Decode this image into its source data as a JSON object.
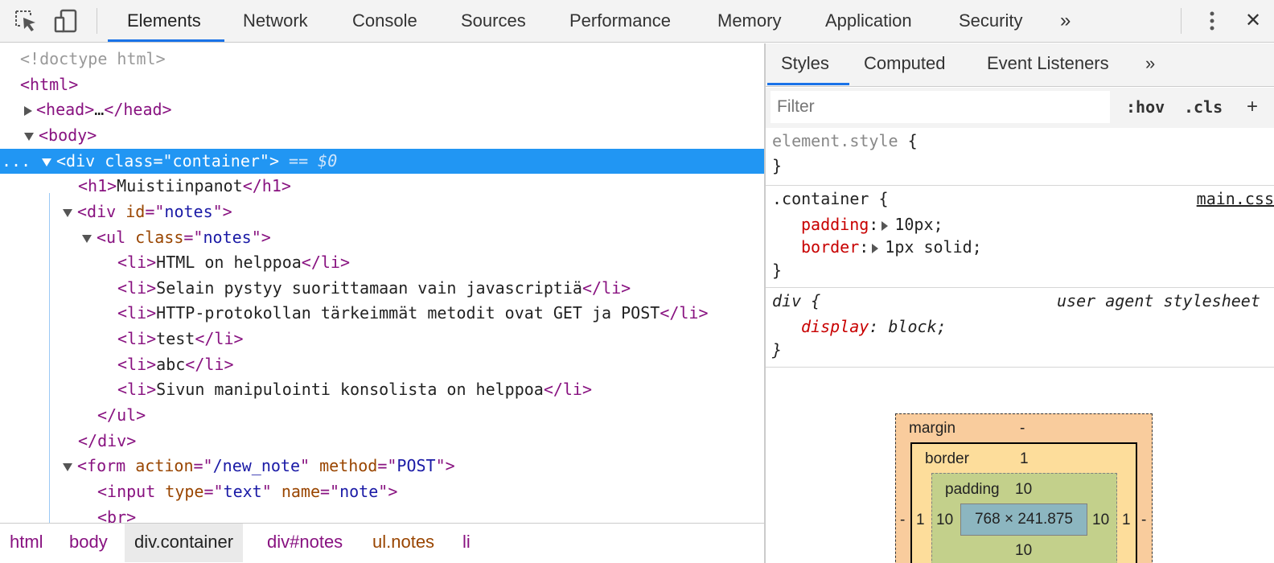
{
  "toolbar": {
    "tabs": [
      "Elements",
      "Network",
      "Console",
      "Sources",
      "Performance",
      "Memory",
      "Application",
      "Security"
    ],
    "more": "»",
    "menu_icon": "kebab-icon",
    "close": "✕"
  },
  "dom": {
    "doctype": "<!doctype html>",
    "html_open": "<html>",
    "head": {
      "open": "<head>",
      "ellipsis": "…",
      "close": "</head>"
    },
    "body_open": "<body>",
    "selected": {
      "dots": "...",
      "open": "<div",
      "attr": "class",
      "eq": "=\"",
      "val": "container",
      "end": "\">",
      "marker": " == ",
      "ref": "$0"
    },
    "h1": {
      "open": "<h1>",
      "text": "Muistiinpanot",
      "close": "</h1>"
    },
    "div_notes": {
      "open": "<div",
      "attr": "id",
      "val": "notes",
      "end": ">"
    },
    "ul_notes": {
      "open": "<ul",
      "attr": "class",
      "val": "notes",
      "end": ">"
    },
    "li_open": "<li>",
    "li_close": "</li>",
    "items": [
      "HTML on helppoa",
      "Selain pystyy suorittamaan vain javascriptiä",
      "HTTP-protokollan tärkeimmät metodit ovat GET ja POST",
      "test",
      "abc",
      "Sivun manipulointi konsolista on helppoa"
    ],
    "ul_close": "</ul>",
    "div_close": "</div>",
    "form": {
      "open": "<form",
      "attr1": "action",
      "val1": "/new_note",
      "attr2": "method",
      "val2": "POST",
      "end": ">"
    },
    "input": {
      "open": "<input",
      "attr1": "type",
      "val1": "text",
      "attr2": "name",
      "val2": "note",
      "end": ">"
    },
    "br": "<br>"
  },
  "breadcrumb": [
    {
      "label": "html",
      "kind": "tag"
    },
    {
      "label": "body",
      "kind": "tag"
    },
    {
      "label": "div.container",
      "kind": "active"
    },
    {
      "label": "div#notes",
      "kind": "id"
    },
    {
      "label": "ul.notes",
      "kind": "class"
    },
    {
      "label": "li",
      "kind": "tag"
    }
  ],
  "styles": {
    "tabs": [
      "Styles",
      "Computed",
      "Event Listeners"
    ],
    "more": "»",
    "filter_placeholder": "Filter",
    "hov": ":hov",
    "cls": ".cls",
    "add": "+",
    "element_style": {
      "selector": "element.style",
      "open": "{",
      "close": "}"
    },
    "container_rule": {
      "selector": ".container",
      "open": "{",
      "source": "main.css",
      "props": [
        {
          "name": "padding",
          "value": "10px;"
        },
        {
          "name": "border",
          "value": "1px solid;"
        }
      ],
      "close": "}"
    },
    "div_rule": {
      "selector": "div",
      "open": "{",
      "source": "user agent stylesheet",
      "prop_name": "display",
      "prop_value": "block;",
      "close": "}"
    }
  },
  "box_model": {
    "margin_label": "margin",
    "margin_top": "-",
    "margin_left": "-",
    "margin_right": "-",
    "border_label": "border",
    "border_top": "1",
    "border_left": "1",
    "border_right": "1",
    "padding_label": "padding",
    "padding_top": "10",
    "padding_left": "10",
    "padding_right": "10",
    "padding_bottom": "10",
    "content": "768 × 241.875"
  },
  "colors": {
    "accent": "#1a73e8",
    "selection": "#2196f3",
    "tag": "#881280",
    "attr_name": "#994500",
    "attr_value": "#1a1aa6",
    "css_prop": "#c80000"
  }
}
